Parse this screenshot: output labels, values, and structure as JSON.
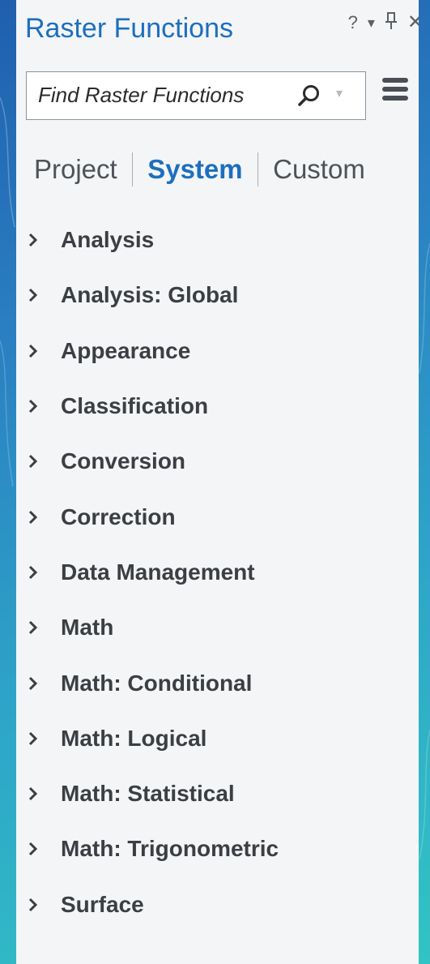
{
  "panel": {
    "title": "Raster Functions",
    "title_buttons": {
      "help": "?",
      "options": "▾",
      "pin": "⊥",
      "close": "✕"
    }
  },
  "search": {
    "placeholder": "Find Raster Functions",
    "value": ""
  },
  "tabs": [
    {
      "label": "Project",
      "active": false
    },
    {
      "label": "System",
      "active": true
    },
    {
      "label": "Custom",
      "active": false
    }
  ],
  "tree_items": [
    {
      "label": "Analysis"
    },
    {
      "label": "Analysis: Global"
    },
    {
      "label": "Appearance"
    },
    {
      "label": "Classification"
    },
    {
      "label": "Conversion"
    },
    {
      "label": "Correction"
    },
    {
      "label": "Data Management"
    },
    {
      "label": "Math"
    },
    {
      "label": "Math: Conditional"
    },
    {
      "label": "Math: Logical"
    },
    {
      "label": "Math: Statistical"
    },
    {
      "label": "Math: Trigonometric"
    },
    {
      "label": "Surface"
    }
  ],
  "colors": {
    "accent": "#1c6fbf",
    "panel_bg": "#f4f5f6",
    "text": "#3b3f43"
  }
}
